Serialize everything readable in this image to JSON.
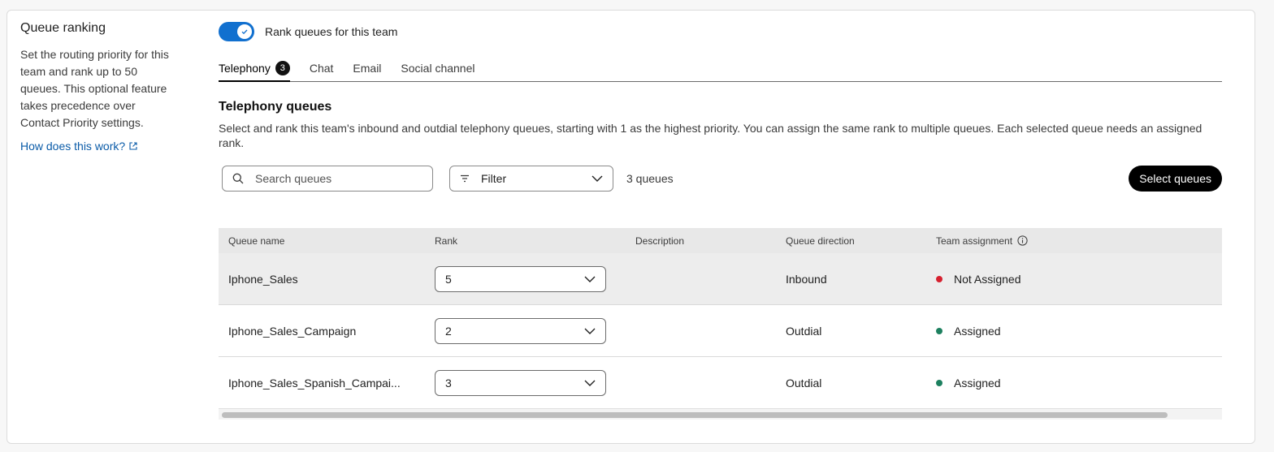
{
  "sidebar": {
    "title": "Queue ranking",
    "description": "Set the routing priority for this team and rank up to 50 queues. This optional feature takes precedence over Contact Priority settings.",
    "help_link": "How does this work?"
  },
  "toggle": {
    "label": "Rank queues for this team",
    "on": true
  },
  "tabs": [
    {
      "label": "Telephony",
      "badge": "3",
      "active": true
    },
    {
      "label": "Chat"
    },
    {
      "label": "Email"
    },
    {
      "label": "Social channel"
    }
  ],
  "section": {
    "title": "Telephony queues",
    "description": "Select and rank this team's inbound and outdial telephony queues, starting with 1 as the highest priority. You can assign the same rank to multiple queues. Each selected queue needs an assigned rank."
  },
  "controls": {
    "search_placeholder": "Search queues",
    "filter_label": "Filter",
    "count": "3 queues",
    "select_button": "Select queues"
  },
  "table": {
    "headers": [
      "Queue name",
      "Rank",
      "Description",
      "Queue direction",
      "Team assignment"
    ],
    "rows": [
      {
        "name": "Iphone_Sales",
        "rank": "5",
        "description": "",
        "direction": "Inbound",
        "assignment": "Not Assigned",
        "status_color": "#d6202f"
      },
      {
        "name": "Iphone_Sales_Campaign",
        "rank": "2",
        "description": "",
        "direction": "Outdial",
        "assignment": "Assigned",
        "status_color": "#1d805f"
      },
      {
        "name": "Iphone_Sales_Spanish_Campai...",
        "rank": "3",
        "description": "",
        "direction": "Outdial",
        "assignment": "Assigned",
        "status_color": "#1d805f"
      }
    ]
  },
  "colors": {
    "accent": "#1170cf",
    "link": "#0a5ba8"
  }
}
